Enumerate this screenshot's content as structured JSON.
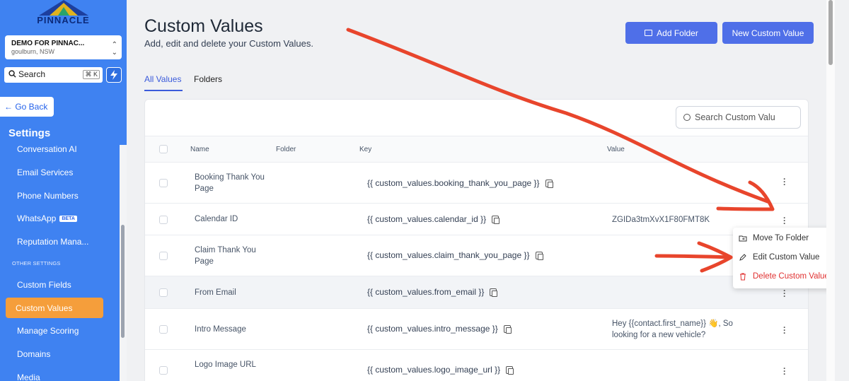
{
  "sidebar": {
    "logo_text": "PINNACLE",
    "location_name": "DEMO FOR PINNAC...",
    "location_sub": "goulburn, NSW",
    "search_label": "Search",
    "search_shortcut": "⌘ K",
    "go_back": "← Go Back",
    "settings_title": "Settings",
    "items_top": [
      "Conversation AI",
      "Email Services",
      "Phone Numbers",
      "WhatsApp",
      "Reputation Mana..."
    ],
    "beta_badge": "BETA",
    "other_settings_label": "OTHER SETTINGS",
    "items_bottom": [
      "Custom Fields",
      "Custom Values",
      "Manage Scoring",
      "Domains",
      "Media"
    ],
    "active_item": "Custom Values"
  },
  "header": {
    "title": "Custom Values",
    "subtitle": "Add, edit and delete your Custom Values.",
    "add_folder": "Add Folder",
    "new_custom_value": "New Custom Value"
  },
  "tabs": [
    {
      "label": "All Values",
      "active": true
    },
    {
      "label": "Folders",
      "active": false
    }
  ],
  "table": {
    "search_placeholder": "Search Custom Valu",
    "columns": [
      "Name",
      "Folder",
      "Key",
      "Value"
    ],
    "rows": [
      {
        "name": "Booking Thank You Page",
        "key": "{{ custom_values.booking_thank_you_page }}",
        "value": ""
      },
      {
        "name": "Calendar ID",
        "key": "{{ custom_values.calendar_id }}",
        "value": "ZGIDa3tmXvX1F80FMT8K"
      },
      {
        "name": "Claim Thank You Page",
        "key": "{{ custom_values.claim_thank_you_page }}",
        "value": ""
      },
      {
        "name": "From Email",
        "key": "{{ custom_values.from_email }}",
        "value": ""
      },
      {
        "name": "Intro Message",
        "key": "{{ custom_values.intro_message }}",
        "value": "Hey {{contact.first_name}} 👋, So looking for a new vehicle?"
      },
      {
        "name": "Logo Image URL",
        "key": "{{ custom_values.logo_image_url }}",
        "value": ""
      }
    ]
  },
  "context_menu": {
    "move": "Move To Folder",
    "edit": "Edit Custom Value",
    "delete": "Delete Custom Value"
  },
  "colors": {
    "sidebar": "#3f82f1",
    "accent": "#4f6fe8",
    "active_nav": "#f59e3b",
    "annotation": "#e8452c",
    "danger": "#e03131"
  }
}
